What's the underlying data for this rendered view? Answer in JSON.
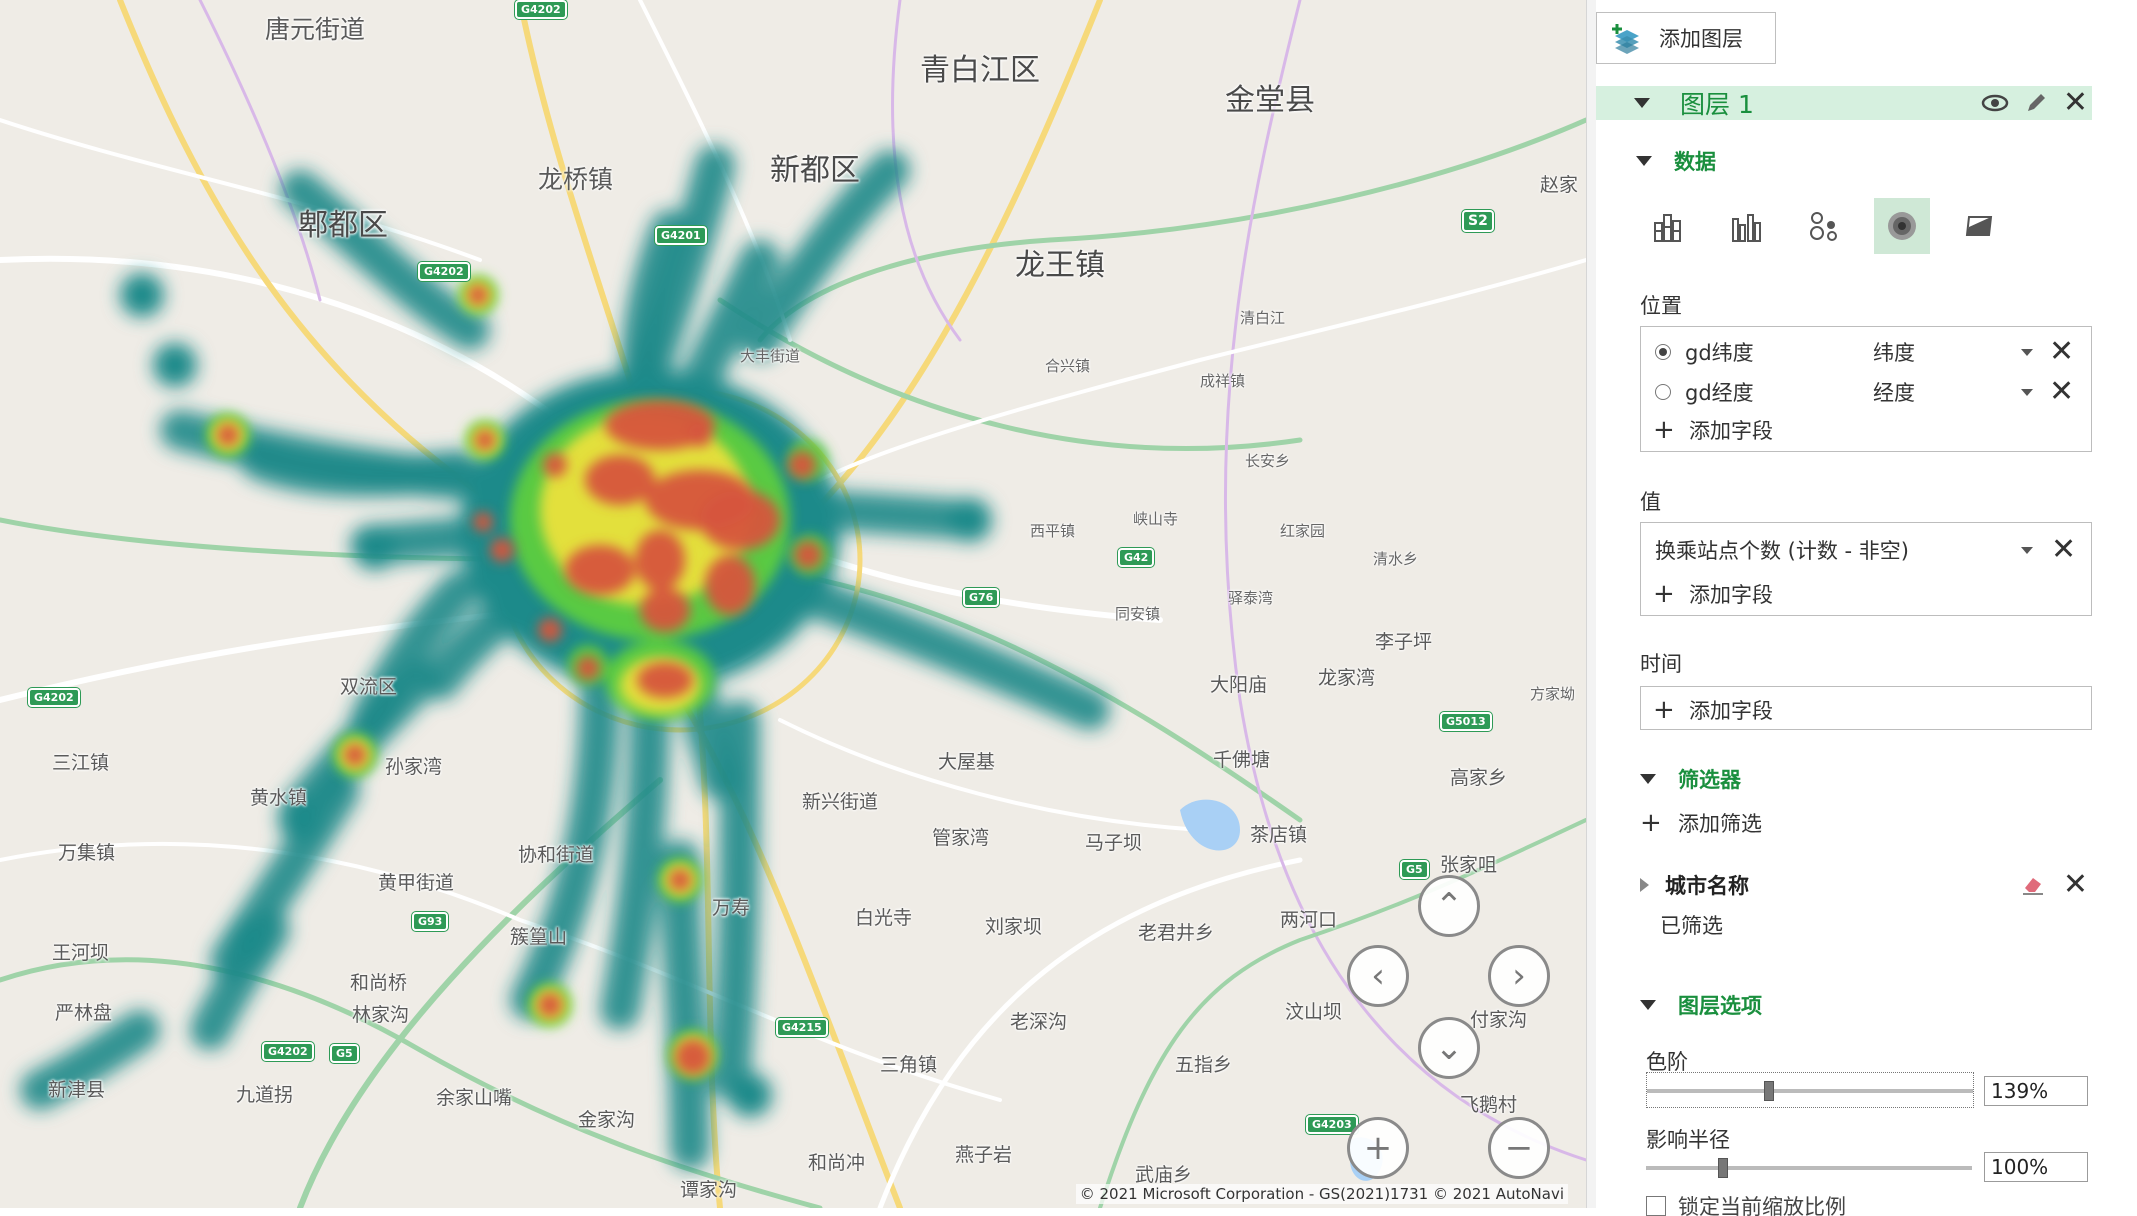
{
  "map": {
    "places_big": [
      "青白江区",
      "金堂县",
      "新都区",
      "郫都区",
      "龙王镇",
      "龙桥镇",
      "唐元街道"
    ],
    "places_mid": [
      "新津县",
      "九道拐",
      "余家山嘴",
      "金家沟",
      "三角镇",
      "和尚冲",
      "燕子岩",
      "五指乡",
      "老深沟",
      "刘家坝",
      "老君井乡",
      "白光寺",
      "两河口",
      "万寿",
      "协和街道",
      "黄甲街道",
      "孙家湾",
      "管家湾",
      "马子坝",
      "茶店镇",
      "大屋基",
      "新兴街道",
      "高家乡",
      "龙家湾",
      "大阳庙",
      "千佛塘",
      "李子坪",
      "三江镇",
      "万集镇",
      "王河坝",
      "严林盘",
      "黄水镇",
      "和尚桥",
      "林家沟",
      "簇篁山",
      "双流区",
      "武庙乡",
      "谭家沟",
      "付家沟",
      "汶山坝",
      "飞鹅村",
      "张家咀",
      "赵家",
      "方家坳",
      "西平镇",
      "同安镇",
      "峡山寺",
      "红家园",
      "清水乡",
      "驿泰湾",
      "长安乡",
      "成祥镇",
      "合兴镇",
      "清白江",
      "大丰街道"
    ],
    "shields": [
      "G4202",
      "G4201",
      "S2",
      "G4202",
      "G5",
      "G76",
      "G4215",
      "G42",
      "G93",
      "G4202",
      "G5",
      "G5013",
      "G4202",
      "G4203"
    ],
    "copyright": "© 2021 Microsoft Corporation - GS(2021)1731  © 2021 AutoNavi",
    "nav": {
      "up": "⌃",
      "left": "‹",
      "right": "›",
      "down": "⌄",
      "zoom_in": "+",
      "zoom_out": "−"
    }
  },
  "panel": {
    "add_layer_label": "添加图层",
    "layer_name": "图层 1",
    "data_section": "数据",
    "position_label": "位置",
    "position_fields": [
      {
        "field": "gd纬度",
        "type": "纬度",
        "selected": true
      },
      {
        "field": "gd经度",
        "type": "经度",
        "selected": false
      }
    ],
    "add_field_label": "添加字段",
    "value_label": "值",
    "value_field": "换乘站点个数 (计数 - 非空)",
    "time_label": "时间",
    "filter_section": "筛选器",
    "add_filter_label": "添加筛选",
    "filter_field": "城市名称",
    "filter_status": "已筛选",
    "layer_options_section": "图层选项",
    "color_scale_label": "色阶",
    "color_scale_value": "139%",
    "color_scale_fraction": 0.36,
    "radius_label": "影响半径",
    "radius_value": "100%",
    "radius_fraction": 0.22,
    "bottom_cut_text": "锁定当前缩放比例"
  },
  "colors": {
    "accent_green": "#1a8f3e",
    "layer_header_bg": "#d6f0df",
    "heat_low": "#1f8a8a",
    "heat_mid": "#5fd13a",
    "heat_high": "#d6543d"
  }
}
